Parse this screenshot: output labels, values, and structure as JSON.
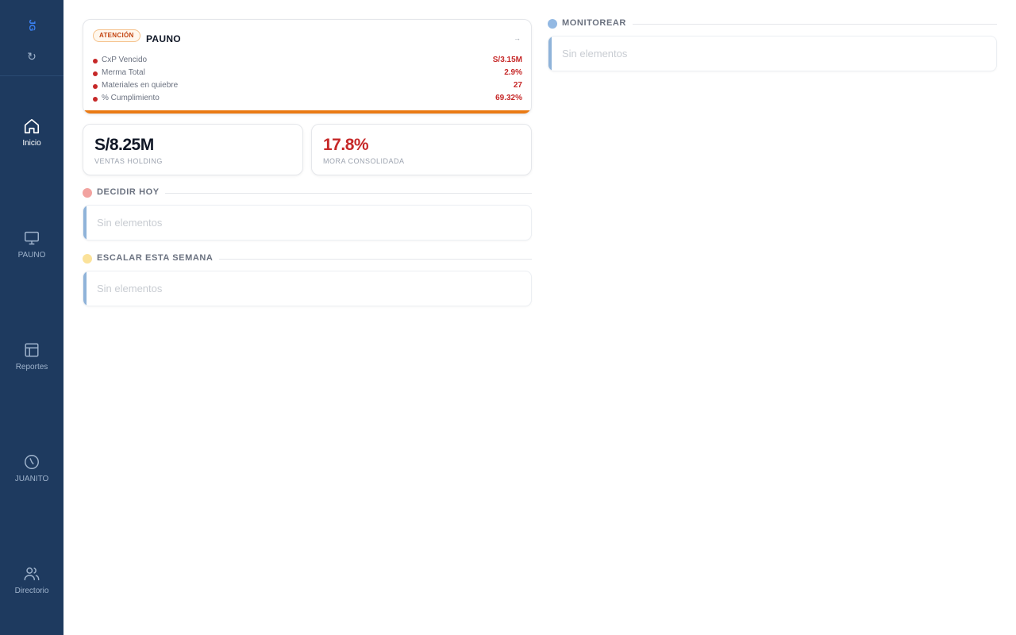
{
  "sidebar": {
    "logo_text": "JG",
    "refresh_glyph": "↻",
    "items": [
      {
        "label": "Inicio",
        "icon": "home-icon",
        "active": true
      },
      {
        "label": "PAUNO",
        "icon": "monitor-icon",
        "active": false
      },
      {
        "label": "Reportes",
        "icon": "layout-icon",
        "active": false
      },
      {
        "label": "JUANITO",
        "icon": "clock-icon",
        "active": false
      },
      {
        "label": "Directorio",
        "icon": "users-icon",
        "active": false
      }
    ]
  },
  "alert_card": {
    "badge": "ATENCIÓN",
    "company": "PAUNO",
    "arrow": "→",
    "metrics": [
      {
        "label": "CxP Vencido",
        "value": "S/3.15M"
      },
      {
        "label": "Merma Total",
        "value": "2.9%"
      },
      {
        "label": "Materiales en quiebre",
        "value": "27"
      },
      {
        "label": "% Cumplimiento",
        "value": "69.32%"
      }
    ],
    "colors": {
      "badge": "#c2410c",
      "metric": "#c62828",
      "bar": "#ea7a14"
    }
  },
  "kpis": [
    {
      "value": "S/8.25M",
      "label": "VENTAS HOLDING",
      "color": "#111827"
    },
    {
      "value": "17.8%",
      "label": "MORA CONSOLIDADA",
      "color": "#c62828"
    }
  ],
  "sections": {
    "decidir": {
      "title": "DECIDIR HOY",
      "dot_color": "#f2a3a0",
      "empty": "Sin elementos"
    },
    "escalar": {
      "title": "ESCALAR ESTA SEMANA",
      "dot_color": "#fbe29a",
      "empty": "Sin elementos"
    },
    "monitorear": {
      "title": "MONITOREAR",
      "dot_color": "#93b9e3",
      "empty": "Sin elementos"
    }
  }
}
